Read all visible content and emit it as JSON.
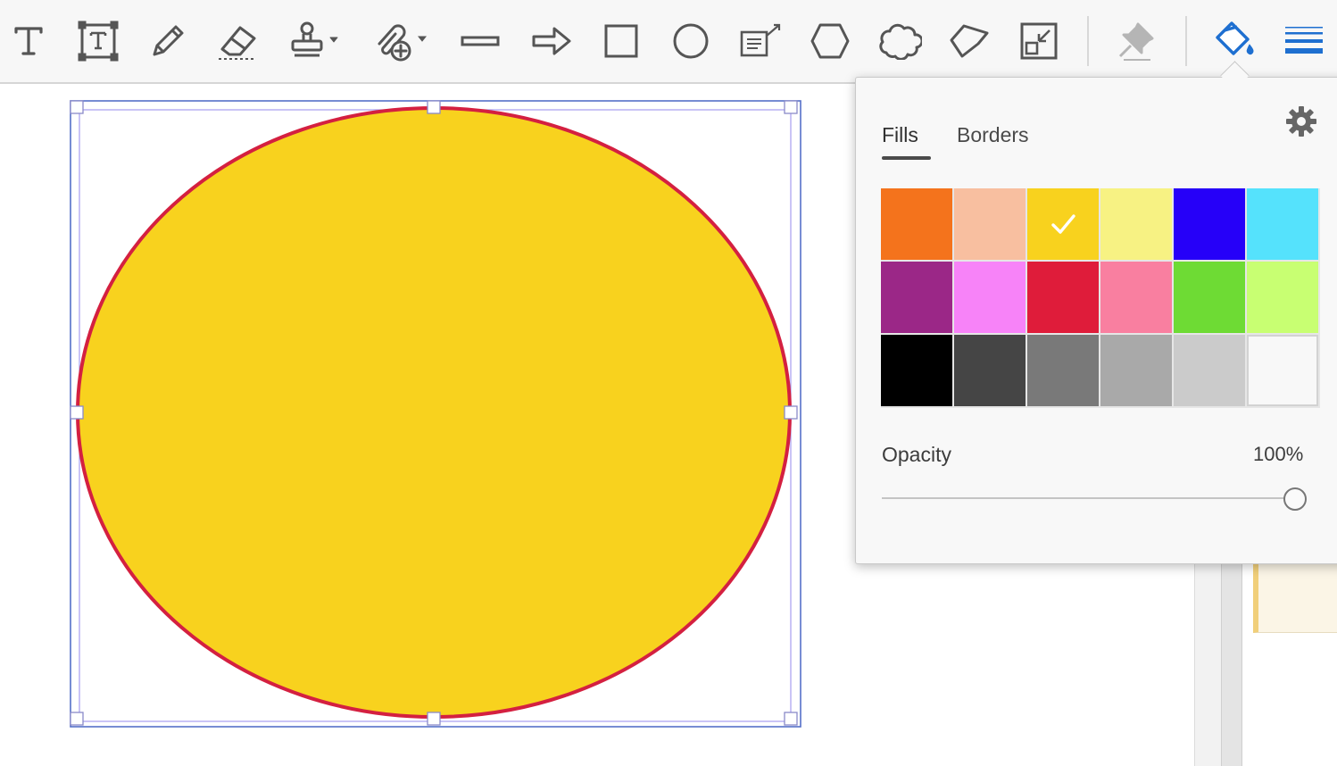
{
  "toolbar": {
    "tools": [
      {
        "name": "add-text",
        "icon": "text-T-icon"
      },
      {
        "name": "text-box",
        "icon": "text-box-icon"
      },
      {
        "name": "pencil",
        "icon": "pencil-icon"
      },
      {
        "name": "eraser",
        "icon": "eraser-icon"
      },
      {
        "name": "stamp",
        "icon": "stamp-icon",
        "dropdown": true
      },
      {
        "name": "attach-file",
        "icon": "paperclip-add-icon",
        "dropdown": true
      },
      {
        "name": "line",
        "icon": "line-icon"
      },
      {
        "name": "arrow",
        "icon": "arrow-icon"
      },
      {
        "name": "rectangle",
        "icon": "rectangle-icon"
      },
      {
        "name": "oval",
        "icon": "oval-icon"
      },
      {
        "name": "text-callout",
        "icon": "callout-icon"
      },
      {
        "name": "polygon",
        "icon": "hexagon-icon"
      },
      {
        "name": "cloud",
        "icon": "cloud-icon"
      },
      {
        "name": "polygon-line",
        "icon": "polyline-icon"
      },
      {
        "name": "arrange",
        "icon": "arrange-icon"
      },
      {
        "name": "keep-tool-selected",
        "icon": "pin-icon"
      },
      {
        "name": "fill-color",
        "icon": "paint-bucket-icon",
        "active": true
      },
      {
        "name": "line-width",
        "icon": "line-weight-icon"
      }
    ]
  },
  "shape": {
    "type": "ellipse",
    "fill": "#F8D21E",
    "stroke": "#D42040"
  },
  "popover": {
    "tabs": [
      {
        "label": "Fills",
        "active": true
      },
      {
        "label": "Borders",
        "active": false
      }
    ],
    "settings_icon": "gear-icon",
    "swatches": [
      "#F4731C",
      "#F8BFA0",
      "#F8D21E",
      "#F7F283",
      "#2600F8",
      "#55E2FC",
      "#9B2787",
      "#F783F8",
      "#DF1C3A",
      "#F97FA0",
      "#6EDB34",
      "#C8FF72",
      "#000000",
      "#454545",
      "#797979",
      "#A9A9A9",
      "#CBCBCB",
      "none"
    ],
    "selected_swatch": 2,
    "opacity": {
      "label": "Opacity",
      "value": "100%",
      "fraction": 1.0
    }
  },
  "colors": {
    "accent": "#1E6FD0",
    "toolbar_icon": "#555555"
  }
}
